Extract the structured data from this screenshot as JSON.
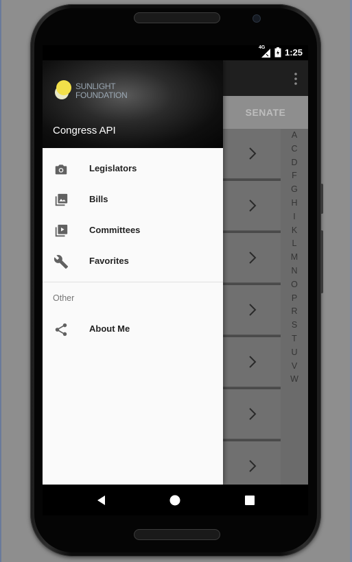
{
  "status_bar": {
    "network": "4G",
    "time": "1:25"
  },
  "app": {
    "tabs": [
      "SENATE"
    ],
    "alphabet_index": [
      "A",
      "C",
      "D",
      "F",
      "G",
      "H",
      "I",
      "K",
      "L",
      "M",
      "N",
      "O",
      "P",
      "R",
      "S",
      "T",
      "U",
      "V",
      "W"
    ]
  },
  "drawer": {
    "header": {
      "logo_line1": "SUNLIGHT",
      "logo_line2": "FOUNDATION",
      "title": "Congress API"
    },
    "items": [
      {
        "label": "Legislators",
        "icon": "camera-icon"
      },
      {
        "label": "Bills",
        "icon": "photo-library-icon"
      },
      {
        "label": "Committees",
        "icon": "video-library-icon"
      },
      {
        "label": "Favorites",
        "icon": "wrench-icon"
      }
    ],
    "section_label": "Other",
    "other_items": [
      {
        "label": "About Me",
        "icon": "share-icon"
      }
    ]
  },
  "colors": {
    "drawer_bg": "#fafafa",
    "header_bg": "#0f0f0f",
    "scrim_list": "#707070",
    "logo_yellow": "#f2e04a"
  }
}
